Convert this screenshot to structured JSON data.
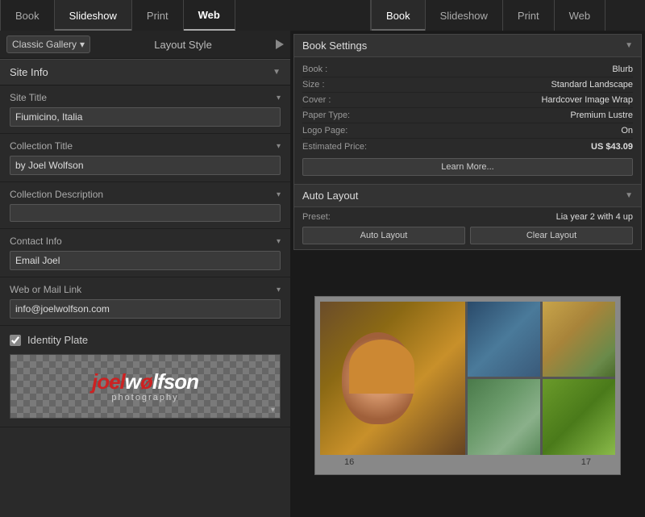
{
  "leftNav": {
    "tabs": [
      {
        "id": "book",
        "label": "Book",
        "active": false
      },
      {
        "id": "slideshow",
        "label": "Slideshow",
        "active": false
      },
      {
        "id": "print",
        "label": "Print",
        "active": false
      },
      {
        "id": "web",
        "label": "Web",
        "active": true
      }
    ]
  },
  "rightNav": {
    "tabs": [
      {
        "id": "book",
        "label": "Book",
        "active": false
      },
      {
        "id": "slideshow",
        "label": "Slideshow",
        "active": false
      },
      {
        "id": "print",
        "label": "Print",
        "active": false
      },
      {
        "id": "web",
        "label": "Web",
        "active": false
      }
    ]
  },
  "leftPanel": {
    "gallerySelect": {
      "value": "Classic Gallery",
      "label": "Classic Gallery"
    },
    "layoutStyleLabel": "Layout Style",
    "siteInfo": {
      "sectionTitle": "Site Info",
      "siteTitle": {
        "label": "Site Title",
        "value": "Fiumicino, Italia"
      },
      "collectionTitle": {
        "label": "Collection Title",
        "value": "by Joel Wolfson"
      },
      "collectionDescription": {
        "label": "Collection Description",
        "value": ""
      },
      "contactInfo": {
        "label": "Contact Info",
        "value": "Email Joel"
      },
      "webOrMailLink": {
        "label": "Web or Mail Link",
        "value": "info@joelwolfson.com"
      }
    },
    "identityPlate": {
      "label": "Identity Plate",
      "checked": true,
      "logoJoel": "joel",
      "logoWolfson": "wølfson",
      "logoPhotography": "photography"
    }
  },
  "rightPanel": {
    "bookSettings": {
      "title": "Book Settings",
      "fields": [
        {
          "key": "Book :",
          "value": "Blurb"
        },
        {
          "key": "Size :",
          "value": "Standard Landscape"
        },
        {
          "key": "Cover :",
          "value": "Hardcover Image Wrap"
        },
        {
          "key": "Paper Type:",
          "value": "Premium Lustre"
        },
        {
          "key": "Logo Page:",
          "value": "On"
        }
      ],
      "estimatedPrice": {
        "key": "Estimated Price:",
        "value": "US $43.09"
      },
      "learnMoreLabel": "Learn More..."
    },
    "autoLayout": {
      "title": "Auto Layout",
      "preset": {
        "key": "Preset:",
        "value": "Lia year 2 with 4 up"
      },
      "autoLayoutButton": "Auto Layout",
      "clearLayoutButton": "Clear Layout"
    },
    "photoGrid": {
      "pageNumbers": [
        "16",
        "17"
      ]
    }
  }
}
